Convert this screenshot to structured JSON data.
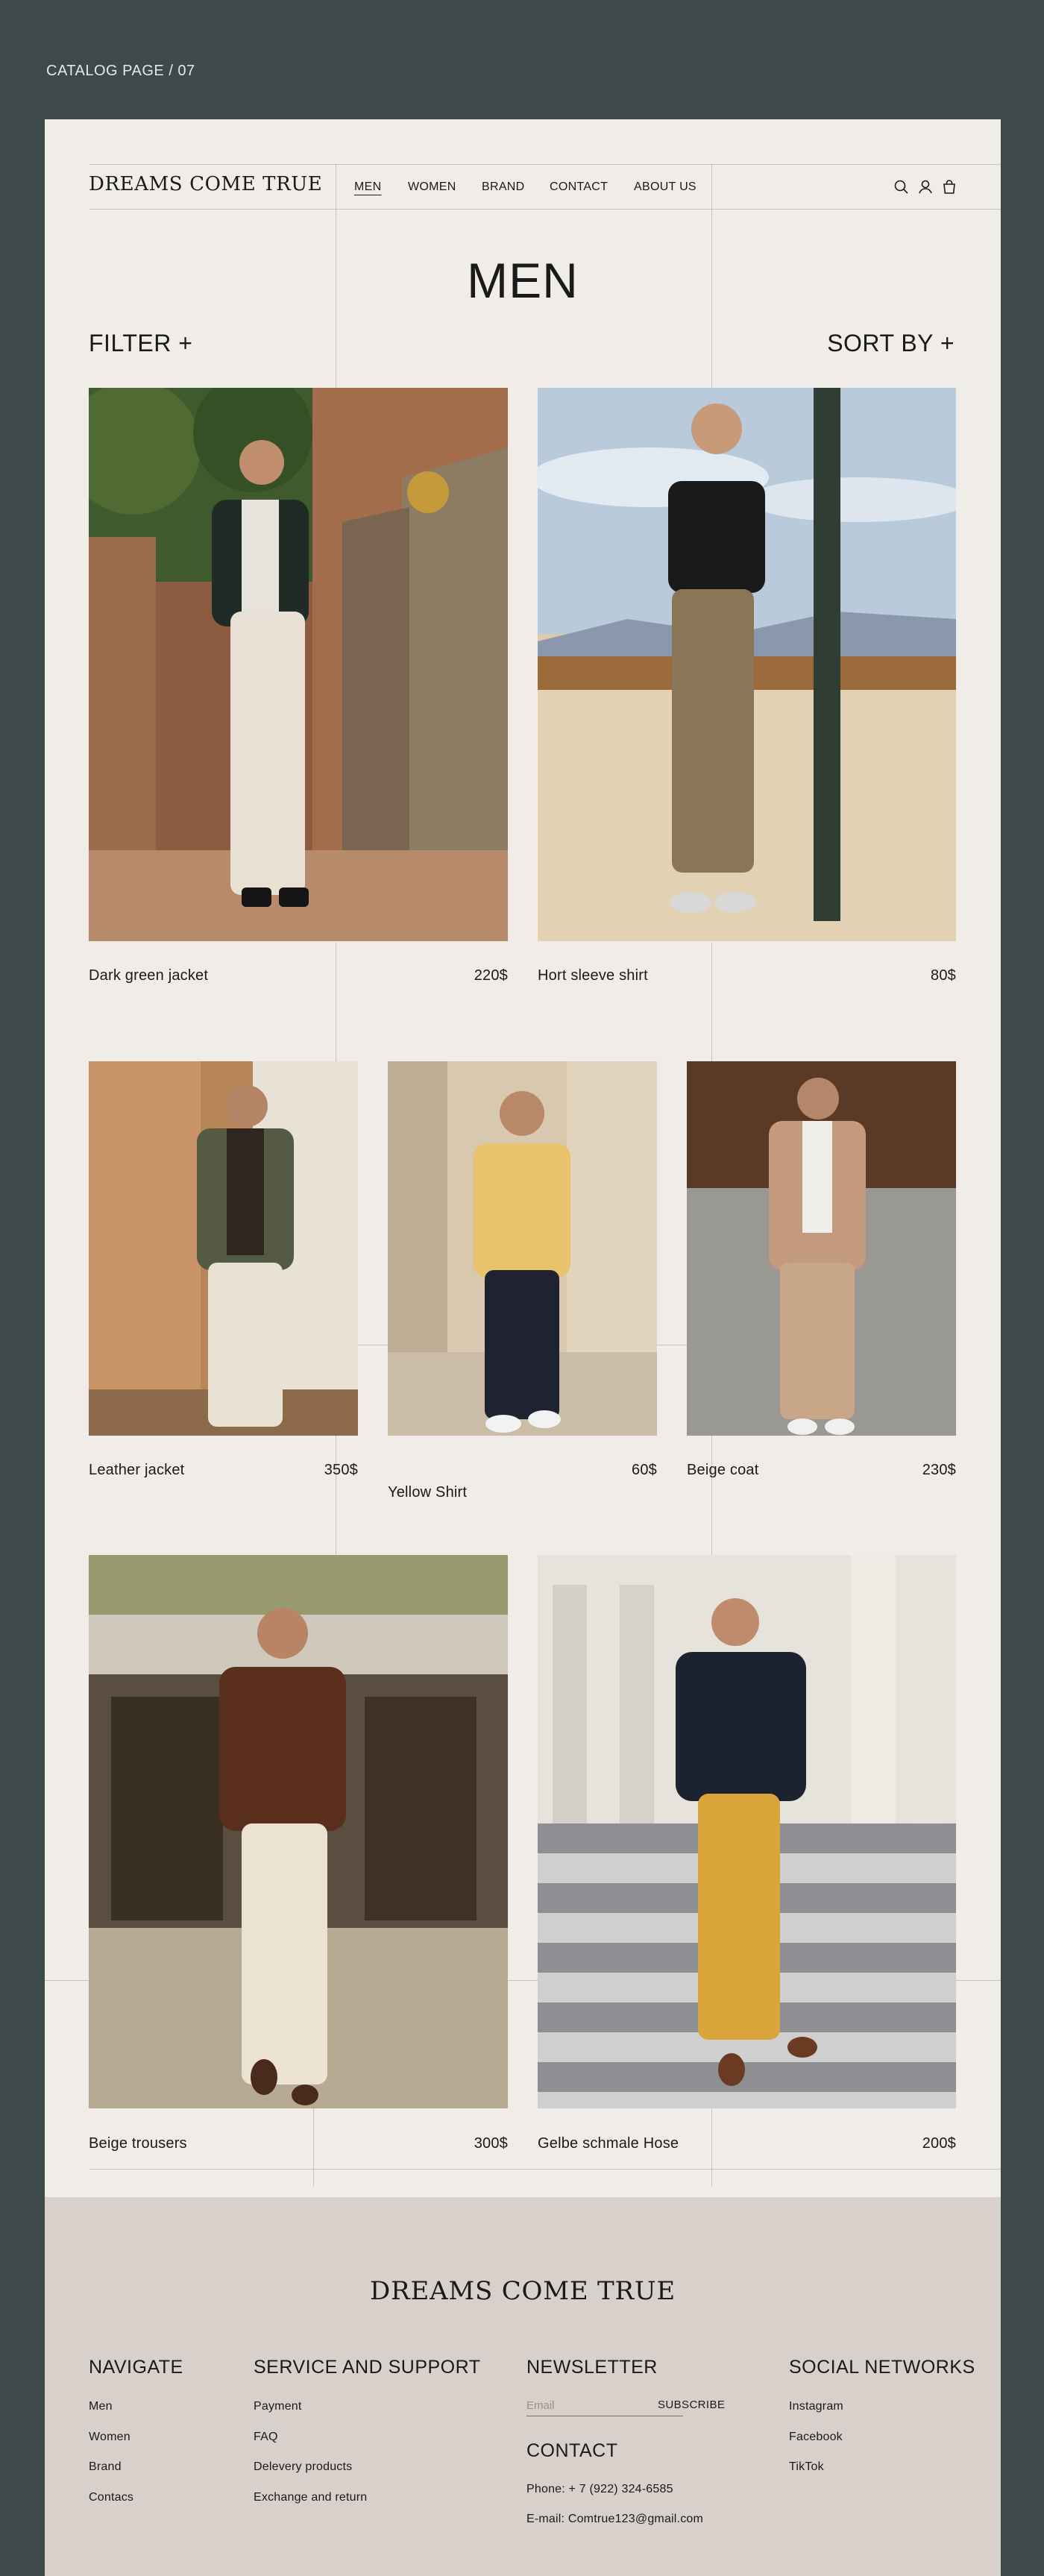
{
  "catalog_label": "CATALOG PAGE / 07",
  "header": {
    "logo": "DREAMS COME TRUE",
    "nav": [
      "MEN",
      "WOMEN",
      "BRAND",
      "CONTACT",
      "ABOUT US"
    ],
    "active_nav": "MEN",
    "icons": [
      "search-icon",
      "user-icon",
      "bag-icon"
    ]
  },
  "page": {
    "title": "MEN",
    "filter_label": "FILTER +",
    "sort_label": "SORT BY +"
  },
  "products": [
    {
      "name": "Dark green jacket",
      "price": "220$"
    },
    {
      "name": "Hort sleeve shirt",
      "price": "80$"
    },
    {
      "name": "Leather jacket",
      "price": "350$"
    },
    {
      "name": "",
      "price": "60$",
      "overlay_label": "Yellow Shirt"
    },
    {
      "name": "Beige coat",
      "price": "230$"
    },
    {
      "name": "Beige trousers",
      "price": "300$"
    },
    {
      "name": "Gelbe schmale Hose",
      "price": "200$"
    }
  ],
  "footer": {
    "logo": "DREAMS COME TRUE",
    "navigate": {
      "title": "NAVIGATE",
      "links": [
        "Men",
        "Women",
        "Brand",
        "Contacs"
      ]
    },
    "support": {
      "title": "SERVICE AND SUPPORT",
      "links": [
        "Payment",
        "FAQ",
        "Delevery products",
        "Exchange and return"
      ]
    },
    "newsletter": {
      "title": "NEWSLETTER",
      "placeholder": "Email",
      "button": "SUBSCRIBE"
    },
    "contact": {
      "title": "CONTACT",
      "phone": "Phone: + 7 (922) 324-6585",
      "email": "E-mail: Comtrue123@gmail.com"
    },
    "social": {
      "title": "SOCIAL NETWORKS",
      "links": [
        "Instagram",
        "Facebook",
        "TikTok"
      ]
    }
  },
  "colors": {
    "outer_background": "#3e4a4a",
    "page_background": "#f0ece8",
    "footer_background": "#d8d0cb",
    "grid_lines": "#c9c2bc",
    "text": "#1a1a1a"
  }
}
